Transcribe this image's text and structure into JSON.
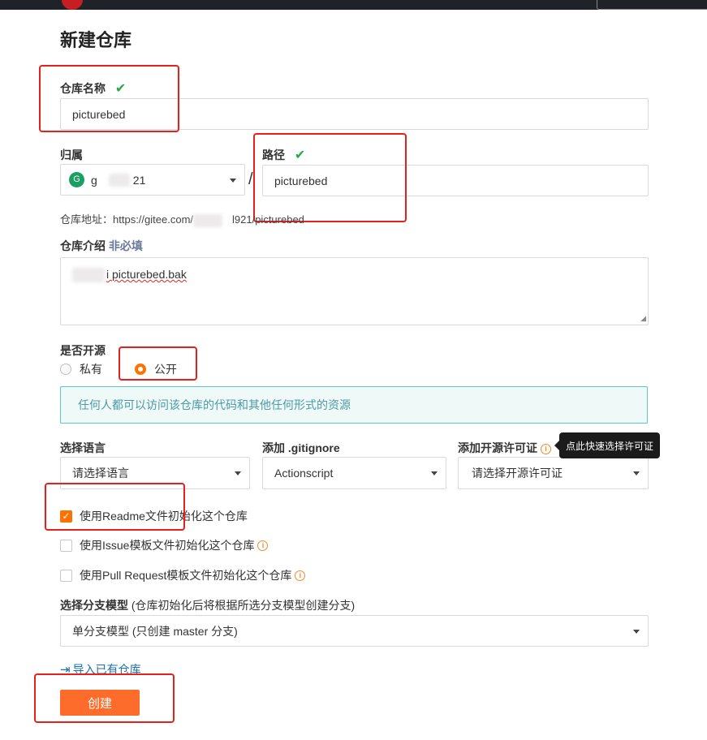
{
  "page": {
    "title": "新建仓库"
  },
  "repo_name": {
    "label": "仓库名称",
    "value": "picturebed"
  },
  "owner": {
    "label": "归属",
    "avatar_letter": "G",
    "value_prefix": "g",
    "value_suffix": "21"
  },
  "path_sep": "/",
  "path": {
    "label": "路径",
    "value": "picturebed"
  },
  "repo_address": {
    "label": "仓库地址：",
    "url_prefix": "https://gitee.com/",
    "url_suffix": "l921/picturebed"
  },
  "description": {
    "label": "仓库介绍",
    "optional": "非必填",
    "value": "i picturebed.bak"
  },
  "visibility": {
    "label": "是否开源",
    "options": [
      {
        "label": "私有",
        "selected": false
      },
      {
        "label": "公开",
        "selected": true
      }
    ],
    "notice": "任何人都可以访问该仓库的代码和其他任何形式的资源"
  },
  "language": {
    "label": "选择语言",
    "value": "请选择语言"
  },
  "gitignore": {
    "label": "添加 .gitignore",
    "value": "Actionscript"
  },
  "license": {
    "label": "添加开源许可证",
    "value": "请选择开源许可证",
    "tooltip": "点此快速选择许可证"
  },
  "init_options": [
    {
      "label": "使用Readme文件初始化这个仓库",
      "checked": true,
      "info": false
    },
    {
      "label": "使用Issue模板文件初始化这个仓库",
      "checked": false,
      "info": true
    },
    {
      "label": "使用Pull Request模板文件初始化这个仓库",
      "checked": false,
      "info": true
    }
  ],
  "branch_model": {
    "label": "选择分支模型",
    "hint": "(仓库初始化后将根据所选分支模型创建分支)",
    "value": "单分支模型 (只创建 master 分支)"
  },
  "import_link": "导入已有仓库",
  "create_button": "创建",
  "colors": {
    "accent": "#fe7300",
    "button": "#fe6c2b",
    "check": "#28a745",
    "annotation": "#e8201b",
    "notice_bg": "#eef9f8",
    "notice_border": "#5cc8bf"
  }
}
